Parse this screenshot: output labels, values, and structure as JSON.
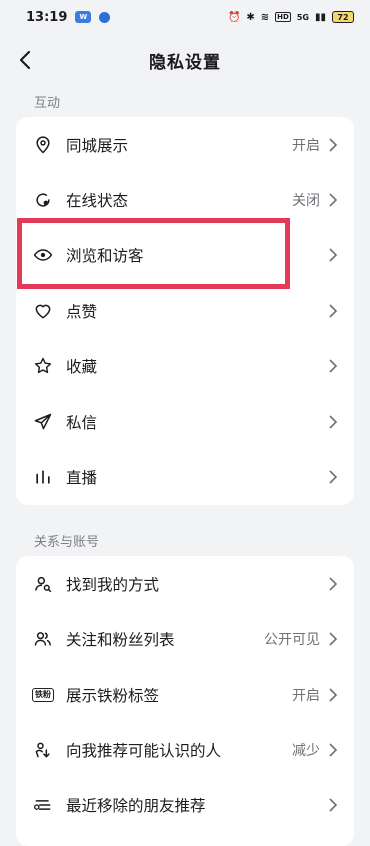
{
  "status_bar": {
    "time": "13:19",
    "chip_label": "W",
    "network": "HD",
    "signal": "5G",
    "battery": "72"
  },
  "header": {
    "title": "隐私设置"
  },
  "sections": [
    {
      "label": "互动",
      "items": [
        {
          "icon": "location-pin-icon",
          "label": "同城展示",
          "value": "开启"
        },
        {
          "icon": "online-status-icon",
          "label": "在线状态",
          "value": "关闭"
        },
        {
          "icon": "eye-icon",
          "label": "浏览和访客",
          "value": ""
        },
        {
          "icon": "heart-icon",
          "label": "点赞",
          "value": ""
        },
        {
          "icon": "star-icon",
          "label": "收藏",
          "value": ""
        },
        {
          "icon": "paper-plane-icon",
          "label": "私信",
          "value": ""
        },
        {
          "icon": "live-bars-icon",
          "label": "直播",
          "value": ""
        }
      ]
    },
    {
      "label": "关系与账号",
      "items": [
        {
          "icon": "find-person-icon",
          "label": "找到我的方式",
          "value": ""
        },
        {
          "icon": "followers-icon",
          "label": "关注和粉丝列表",
          "value": "公开可见"
        },
        {
          "icon": "fan-badge-icon",
          "label": "展示铁粉标签",
          "value": "开启",
          "badge": "铁粉"
        },
        {
          "icon": "recommend-person-icon",
          "label": "向我推荐可能认识的人",
          "value": "减少"
        },
        {
          "icon": "removed-friends-icon",
          "label": "最近移除的朋友推荐",
          "value": ""
        }
      ]
    }
  ],
  "colors": {
    "highlight": "#e33a5a",
    "background": "#f2f3f5"
  }
}
